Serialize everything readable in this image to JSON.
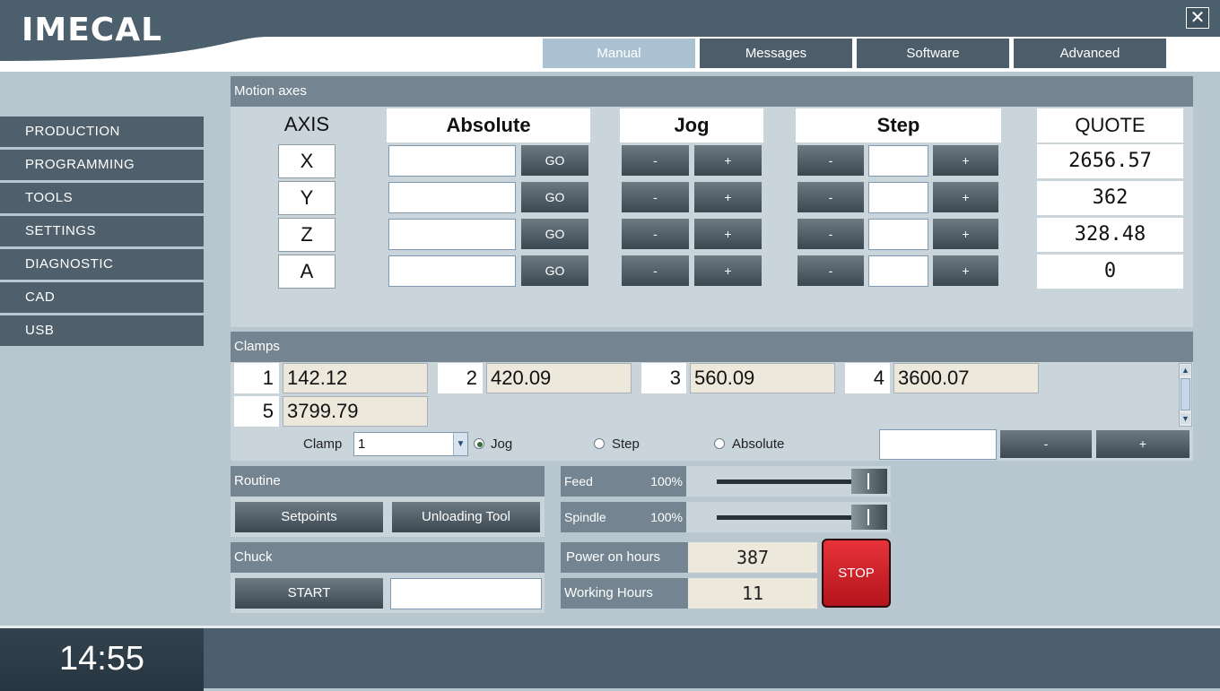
{
  "header": {
    "logo": "IMECAL",
    "tabs": [
      {
        "label": "Manual"
      },
      {
        "label": "Messages"
      },
      {
        "label": "Software"
      },
      {
        "label": "Advanced"
      }
    ]
  },
  "sidebar": {
    "items": [
      {
        "label": "PRODUCTION"
      },
      {
        "label": "PROGRAMMING"
      },
      {
        "label": "TOOLS"
      },
      {
        "label": "SETTINGS"
      },
      {
        "label": "DIAGNOSTIC"
      },
      {
        "label": "CAD"
      },
      {
        "label": "USB"
      }
    ]
  },
  "motion": {
    "title": "Motion axes",
    "axis_header": "AXIS",
    "absolute_header": "Absolute",
    "jog_header": "Jog",
    "step_header": "Step",
    "quote_header": "QUOTE",
    "go_label": "GO",
    "minus_label": "-",
    "plus_label": "+",
    "axes": [
      {
        "name": "X",
        "absolute": "",
        "step": "",
        "quote": "2656.57"
      },
      {
        "name": "Y",
        "absolute": "",
        "step": "",
        "quote": "362"
      },
      {
        "name": "Z",
        "absolute": "",
        "step": "",
        "quote": "328.48"
      },
      {
        "name": "A",
        "absolute": "",
        "step": "",
        "quote": "0"
      }
    ]
  },
  "clamps": {
    "title": "Clamps",
    "items": [
      {
        "num": "1",
        "value": "142.12"
      },
      {
        "num": "2",
        "value": "420.09"
      },
      {
        "num": "3",
        "value": "560.09"
      },
      {
        "num": "4",
        "value": "3600.07"
      },
      {
        "num": "5",
        "value": "3799.79"
      }
    ],
    "clamp_label": "Clamp",
    "clamp_selected": "1",
    "mode_jog": "Jog",
    "mode_step": "Step",
    "mode_absolute": "Absolute",
    "selected_mode": "Jog",
    "value_input": "",
    "minus_label": "-",
    "plus_label": "+"
  },
  "routine": {
    "title": "Routine",
    "setpoints_label": "Setpoints",
    "unloading_label": "Unloading Tool"
  },
  "chuck": {
    "title": "Chuck",
    "start_label": "START",
    "input_value": ""
  },
  "overrides": {
    "feed_label": "Feed",
    "feed_value": "100%",
    "feed_level": 1.0,
    "spindle_label": "Spindle",
    "spindle_value": "100%",
    "spindle_level": 1.0
  },
  "counters": {
    "power_label": "Power on hours",
    "power_value": "387",
    "working_label": "Working Hours",
    "working_value": "11"
  },
  "stop_label": "STOP",
  "footer": {
    "clock": "14:55"
  },
  "colors": {
    "accent_tab": "#a9c1d0",
    "dark": "#4b5f6d",
    "stop": "#d2242a"
  }
}
